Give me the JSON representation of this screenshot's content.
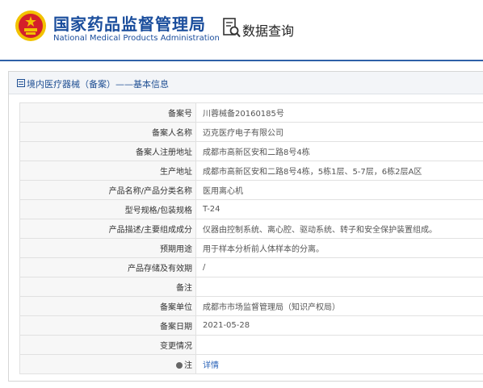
{
  "header": {
    "org_cn": "国家药品监督管理局",
    "org_en": "National Medical Products Administration",
    "query_label": "数据查询"
  },
  "panel": {
    "title": "境内医疗器械（备案）——基本信息"
  },
  "rows": [
    {
      "label": "备案号",
      "value": "川蓉械备20160185号"
    },
    {
      "label": "备案人名称",
      "value": "迈克医疗电子有限公司"
    },
    {
      "label": "备案人注册地址",
      "value": "成都市高新区安和二路8号4栋"
    },
    {
      "label": "生产地址",
      "value": "成都市高新区安和二路8号4栋，5栋1层、5-7层，6栋2层A区"
    },
    {
      "label": "产品名称/产品分类名称",
      "value": "医用离心机"
    },
    {
      "label": "型号规格/包装规格",
      "value": "T-24"
    },
    {
      "label": "产品描述/主要组成成分",
      "value": "仪器由控制系统、离心腔、驱动系统、转子和安全保护装置组成。"
    },
    {
      "label": "预期用途",
      "value": "用于样本分析前人体样本的分离。"
    },
    {
      "label": "产品存储及有效期",
      "value": "/"
    },
    {
      "label": "备注",
      "value": ""
    },
    {
      "label": "备案单位",
      "value": "成都市市场监督管理局（知识产权局）"
    },
    {
      "label": "备案日期",
      "value": "2021-05-28"
    },
    {
      "label": "变更情况",
      "value": ""
    }
  ],
  "note_row": {
    "label": "注",
    "link": "详情"
  },
  "colors": {
    "brand_blue": "#1a4d9c",
    "header_rule": "#2f61a8",
    "link": "#2a63b8",
    "emblem_red": "#d4202a",
    "emblem_gold": "#f2c200"
  },
  "icons": {
    "emblem": "national-emblem-icon",
    "query": "magnifier-document-icon",
    "title": "list-icon",
    "note": "bulb-icon"
  }
}
